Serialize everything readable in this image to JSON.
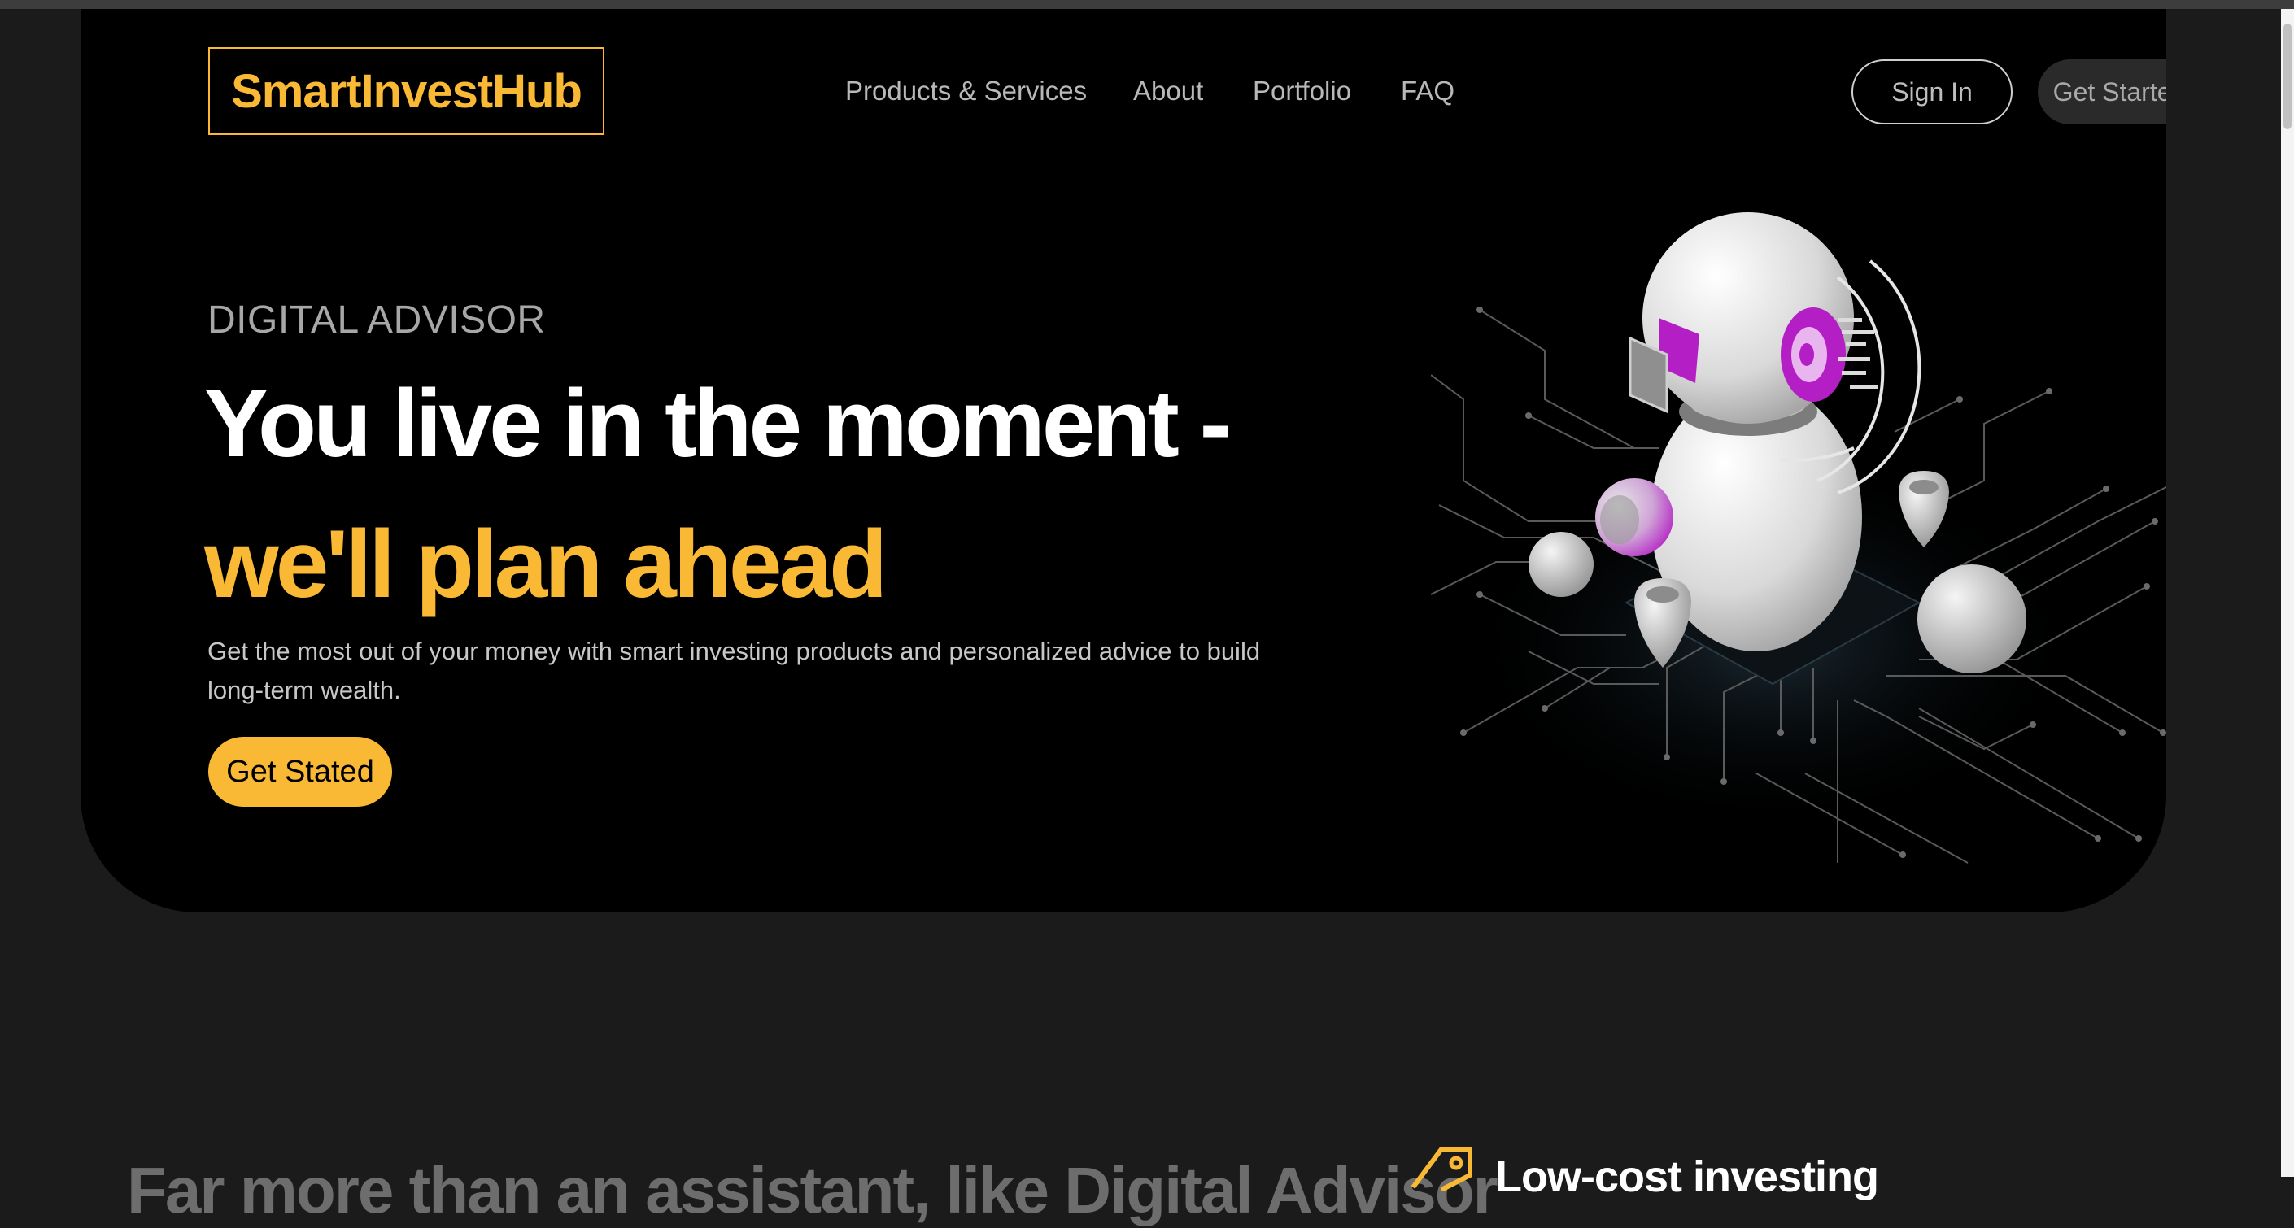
{
  "brand": {
    "name": "SmartInvestHub",
    "accent": "#f9b935"
  },
  "nav": {
    "items": [
      {
        "label": "Products & Services"
      },
      {
        "label": "About"
      },
      {
        "label": "Portfolio"
      },
      {
        "label": "FAQ"
      }
    ],
    "signin_label": "Sign In",
    "getstarted_label": "Get Started"
  },
  "hero": {
    "eyebrow": "DIGITAL ADVISOR",
    "headline_line1": "You live in the moment -",
    "headline_line2": "we'll plan ahead",
    "subtitle": "Get the most out of your money with smart investing products and personalized advice to build long-term wealth.",
    "cta_label": "Get Stated",
    "illustration": "robot-advisor-illustration"
  },
  "next_section": {
    "heading": "Far more than an assistant, like Digital Advisor",
    "feature_title": "Low-cost investing",
    "feature_icon": "price-tag-icon"
  }
}
